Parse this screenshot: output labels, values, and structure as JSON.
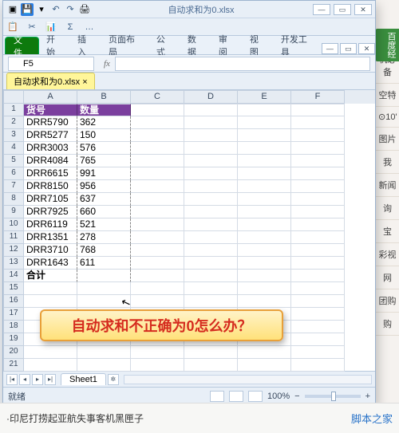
{
  "title_filename": "自动求和为0.xlsx",
  "menu": {
    "file": "文件",
    "home": "开始",
    "insert": "插入",
    "layout": "页面布局",
    "formula": "公式",
    "data": "数据",
    "review": "审阅",
    "view": "视图",
    "dev": "开发工具"
  },
  "namebox": "F5",
  "fx_label": "fx",
  "doc_tab": "自动求和为0.xlsx",
  "cols": [
    "A",
    "B",
    "C",
    "D",
    "E",
    "F"
  ],
  "headers": {
    "a": "货号",
    "b": "数量"
  },
  "rows": [
    {
      "a": "DRR5790",
      "b": "362"
    },
    {
      "a": "DRR5277",
      "b": "150"
    },
    {
      "a": "DRR3003",
      "b": "576"
    },
    {
      "a": "DRR4084",
      "b": "765"
    },
    {
      "a": "DRR6615",
      "b": "991"
    },
    {
      "a": "DRR8150",
      "b": "956"
    },
    {
      "a": "DRR7105",
      "b": "637"
    },
    {
      "a": "DRR7925",
      "b": "660"
    },
    {
      "a": "DRR6119",
      "b": "521"
    },
    {
      "a": "DRR1351",
      "b": "278"
    },
    {
      "a": "DRR3710",
      "b": "768"
    },
    {
      "a": "DRR1643",
      "b": "611"
    }
  ],
  "total_label": "合计",
  "empty_count": 7,
  "callout_text": "自动求和不正确为0怎么办？",
  "sheet_tab": "Sheet1",
  "status_ready": "就绪",
  "zoom_pct": "100%",
  "right_tab": "百度经",
  "right_items": [
    "机必备",
    "空特",
    "⊙10'",
    "图片",
    "我",
    "新闻",
    "询",
    "宝",
    "彩视",
    "网",
    "团购",
    "购"
  ],
  "bottom_news": "·印尼打捞起亚航失事客机黑匣子",
  "brand": "脚本之家"
}
